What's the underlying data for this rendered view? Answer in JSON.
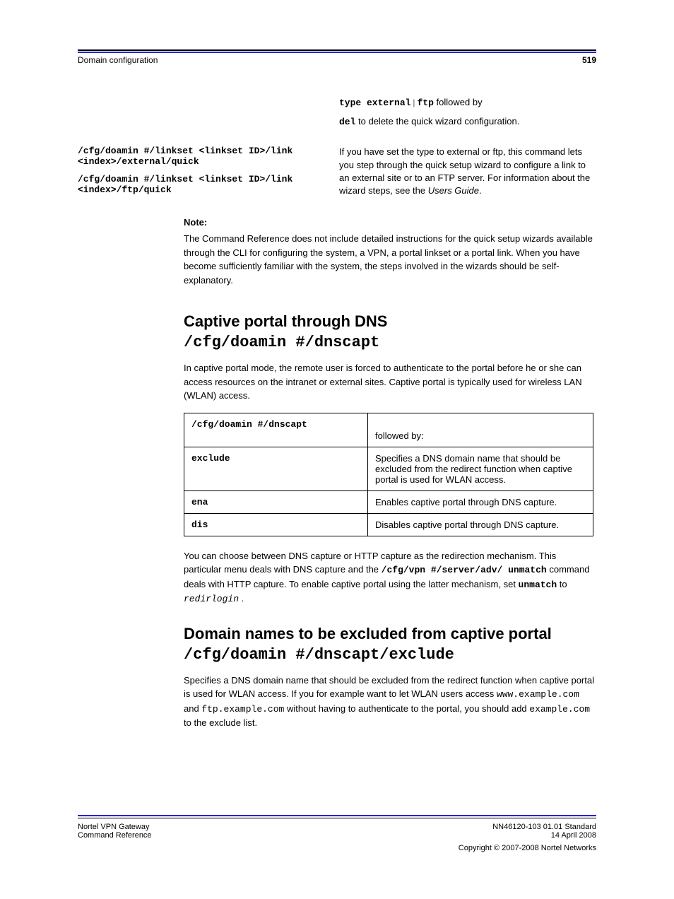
{
  "header": {
    "left": "Domain configuration",
    "right_bold": "519"
  },
  "quick_cfg": {
    "cmd_type_prefix": "type external",
    "cmd_type_sep": " | ",
    "cmd_type_suffix": "ftp",
    "cmd_type_desc": " followed by",
    "cmd_del": "del",
    "cmd_del_desc": " to delete the quick wizard configuration.",
    "left_cmd_1": "/cfg/doamin #/linkset <linkset ID>/link <index>/external/quick",
    "left_cmd_2": "/cfg/doamin #/linkset <linkset ID>/link <index>/ftp/quick",
    "right_para": "If you have set the type to external or ftp, this command lets you step through the quick setup wizard to configure a link to an external site or to an FTP server. For information about the wizard steps, see the",
    "right_para_ital": "Users Guide",
    "right_para_end": "."
  },
  "note": {
    "title": "Note:",
    "body": "The Command Reference does not include detailed instructions for the quick setup wizards available through the CLI for configuring the system, a VPN, a portal linkset or a portal link. When you have become sufficiently familiar with the system, the steps involved in the wizards should be self-explanatory."
  },
  "dnscapt": {
    "title": "Captive portal through DNS",
    "cmd": "/cfg/doamin #/dnscapt",
    "para": "In captive portal mode, the remote user is forced to authenticate to the portal before he or she can access resources on the intranet or external sites. Captive portal is typically used for wireless LAN (WLAN) access."
  },
  "table": {
    "header_cmd": "/cfg/doamin #/dnscapt",
    "header_desc": "followed by:",
    "rows": [
      {
        "cmd": "exclude",
        "desc": "Specifies a DNS domain name that should be excluded from the redirect function when captive portal is used for WLAN access."
      },
      {
        "cmd": "ena",
        "desc": "Enables captive portal through DNS capture."
      },
      {
        "cmd": "dis",
        "desc": "Disables captive portal through DNS capture."
      }
    ]
  },
  "domains_list": {
    "para_pre": "You can choose between DNS capture or HTTP capture as the redirection mechanism. This particular menu deals with DNS capture and the",
    "cmd_1": "/cfg/vpn #/server/adv/ unmatch",
    "para_mid": " command deals with HTTP capture. To enable captive portal using the latter mechanism, set ",
    "cmd_2": "unmatch",
    "para_mid2": " to ",
    "cmd_3": "redirlogin",
    "para_end": "."
  },
  "exclude": {
    "title": "Domain names to be excluded from captive portal",
    "cmd": "/cfg/doamin #/dnscapt/exclude",
    "para": "Specifies a DNS domain name that should be excluded from the redirect function when captive portal is used for WLAN access. If you for example want to let WLAN users access ",
    "mono1": "www.example.com",
    "para2": " and ",
    "mono2": "ftp.example.com",
    "para3": " without having to authenticate to the portal, you should add ",
    "mono3": "example.com",
    "para4": " to the exclude list."
  },
  "footer": {
    "left1": "Nortel VPN Gateway",
    "left2_pre": "Command Reference",
    "right1": "NN46120-103 01.01 Standard",
    "right2": "14 April 2008",
    "copyright": "Copyright © 2007-2008 Nortel Networks"
  }
}
